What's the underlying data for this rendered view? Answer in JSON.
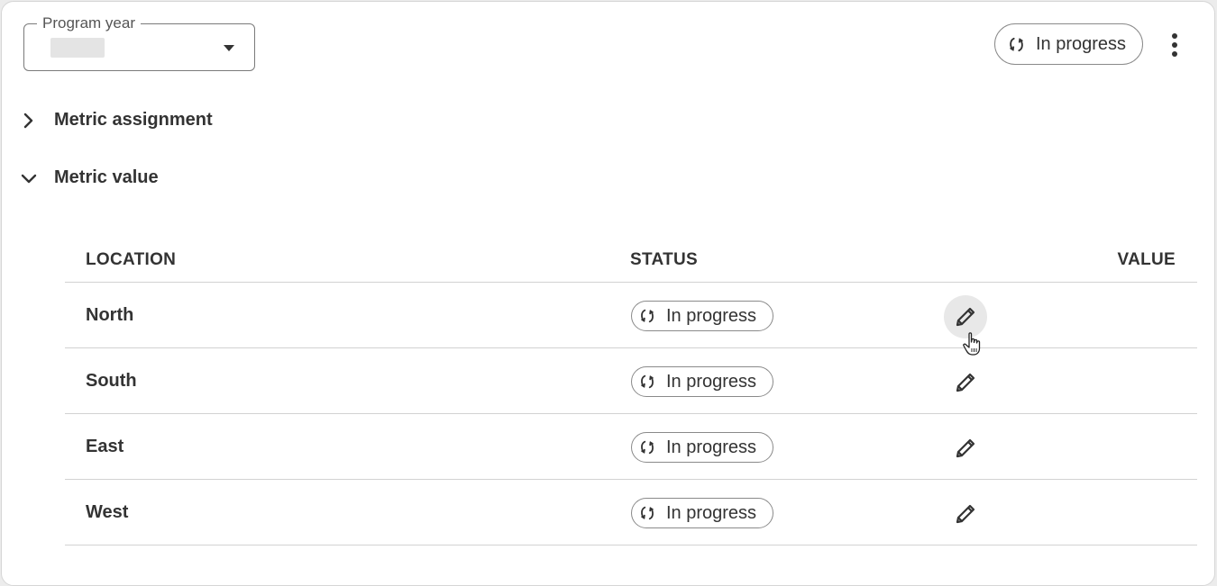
{
  "filter": {
    "label": "Program year",
    "value": ""
  },
  "header": {
    "status_label": "In progress",
    "status_icon": "sync-icon",
    "more_icon": "more-vertical-icon"
  },
  "sections": [
    {
      "title": "Metric assignment",
      "expanded": false
    },
    {
      "title": "Metric value",
      "expanded": true
    }
  ],
  "table": {
    "columns": [
      "LOCATION",
      "STATUS",
      "VALUE"
    ],
    "rows": [
      {
        "location": "North",
        "status": "In progress"
      },
      {
        "location": "South",
        "status": "In progress"
      },
      {
        "location": "East",
        "status": "In progress"
      },
      {
        "location": "West",
        "status": "In progress"
      }
    ],
    "edit_icon": "pencil-icon"
  }
}
